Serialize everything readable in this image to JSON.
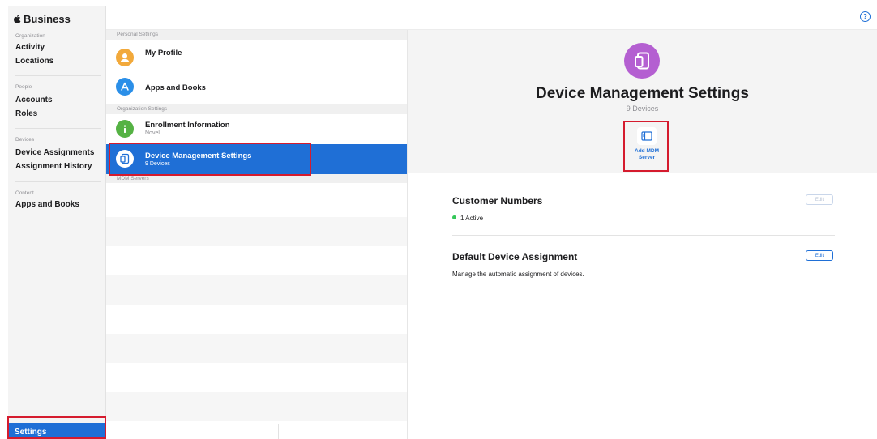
{
  "app": {
    "brand": "Business"
  },
  "sidebar": {
    "sections": [
      {
        "label": "Organization",
        "items": [
          "Activity",
          "Locations"
        ]
      },
      {
        "label": "People",
        "items": [
          "Accounts",
          "Roles"
        ]
      },
      {
        "label": "Devices",
        "items": [
          "Device Assignments",
          "Assignment History"
        ]
      },
      {
        "label": "Content",
        "items": [
          "Apps and Books"
        ]
      }
    ],
    "footer_item": "Settings"
  },
  "settings_list": {
    "groups": [
      {
        "header": "Personal Settings",
        "rows": [
          {
            "title": "My Profile",
            "subtitle": "",
            "icon": "profile-icon",
            "icon_color": "#f2a93b"
          },
          {
            "title": "Apps and Books",
            "subtitle": "",
            "icon": "app-store-icon",
            "icon_color": "#2b8fe8"
          }
        ]
      },
      {
        "header": "Organization Settings",
        "rows": [
          {
            "title": "Enrollment Information",
            "subtitle": "Novell",
            "icon": "info-icon",
            "icon_color": "#55b244"
          },
          {
            "title": "Device Management Settings",
            "subtitle": "9 Devices",
            "icon": "device-icon",
            "icon_color": "#b45fd1",
            "selected": true
          }
        ]
      },
      {
        "header": "MDM Servers",
        "rows": []
      }
    ]
  },
  "detail": {
    "title": "Device Management Settings",
    "subtitle": "9 Devices",
    "icon": "device-icon",
    "icon_color": "#b45fd1",
    "action": {
      "label_line1": "Add MDM",
      "label_line2": "Server",
      "icon": "mdm-server-icon"
    },
    "customer_numbers": {
      "title": "Customer Numbers",
      "status": "1 Active",
      "status_color": "#34c759",
      "edit_label": "Edit"
    },
    "default_assignment": {
      "title": "Default Device Assignment",
      "description": "Manage the automatic assignment of devices.",
      "edit_label": "Edit"
    }
  },
  "help": {
    "icon": "help-icon",
    "glyph": "?"
  },
  "colors": {
    "accent": "#1f6fd6",
    "highlight": "#d51b2e"
  }
}
